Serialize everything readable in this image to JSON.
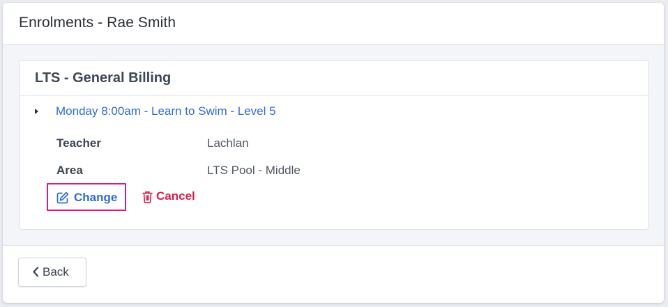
{
  "modal": {
    "title": "Enrolments - Rae Smith"
  },
  "card": {
    "title": "LTS - General Billing",
    "lesson_link": "Monday 8:00am - Learn to Swim - Level 5",
    "details": [
      {
        "label": "Teacher",
        "value": "Lachlan"
      },
      {
        "label": "Area",
        "value": "LTS Pool - Middle"
      }
    ],
    "actions": {
      "change_label": "Change",
      "change_icon": "edit-icon",
      "cancel_label": "Cancel",
      "cancel_icon": "trash-icon"
    }
  },
  "footer": {
    "back_label": "Back",
    "back_icon": "chevron-left-icon"
  },
  "colors": {
    "link": "#2f6bd8",
    "danger": "#d61f4a",
    "highlight": "#e0197e"
  }
}
